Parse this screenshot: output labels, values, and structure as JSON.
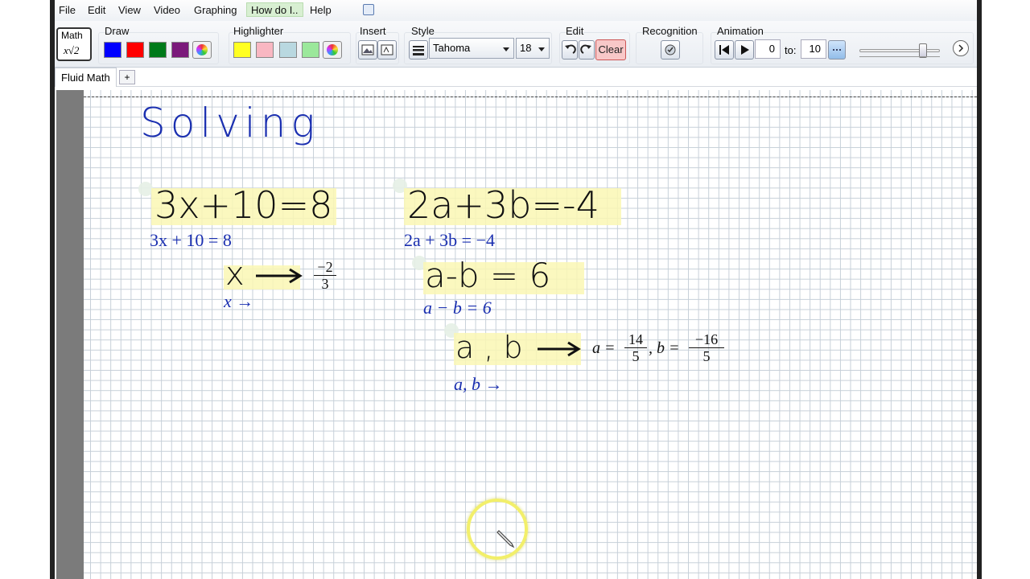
{
  "menu": {
    "file": "File",
    "edit": "Edit",
    "view": "View",
    "video": "Video",
    "graphing": "Graphing",
    "how_do_i": "How do I..",
    "help": "Help"
  },
  "ribbon": {
    "math_label": "Math",
    "math_icon_text": "x√2",
    "draw_label": "Draw",
    "draw_colors": [
      "#0000ff",
      "#ff0000",
      "#007a1a",
      "#7b1a7b"
    ],
    "highlighter_label": "Highlighter",
    "highlighter_colors": [
      "#ffff22",
      "#f9b7c2",
      "#b9d8e0",
      "#9be89b"
    ],
    "insert_label": "Insert",
    "style_label": "Style",
    "font_name": "Tahoma",
    "font_size": "18",
    "edit_label": "Edit",
    "clear_label": "Clear",
    "recognition_label": "Recognition",
    "animation_label": "Animation",
    "anim_from": "0",
    "anim_to_label": "to:",
    "anim_to": "10",
    "anim_slider_value": 0.78
  },
  "tabs": {
    "active": "Fluid Math",
    "add": "+"
  },
  "canvas": {
    "heading": "Solving",
    "eq1_ink": "3x+10=8",
    "eq1_typed": "3x + 10 = 8",
    "solve1_ink": "x",
    "solve1_typed": "x →",
    "solve1_result_num": "−2",
    "solve1_result_den": "3",
    "eq2_ink": "2a+3b=-4",
    "eq2_typed": "2a + 3b = −4",
    "eq3_ink": "a-b = 6",
    "eq3_typed": "a − b = 6",
    "solve2_ink": "a , b",
    "solve2_typed": "a, b →",
    "solve2_a_label": "a =",
    "solve2_a_num": "14",
    "solve2_a_den": "5",
    "solve2_b_label": ", b =",
    "solve2_b_num": "−16",
    "solve2_b_den": "5"
  },
  "colors": {
    "ink_blue": "#1a2fb0",
    "highlight": "#faf7b4",
    "cursor_ring": "#f2ef6a"
  }
}
